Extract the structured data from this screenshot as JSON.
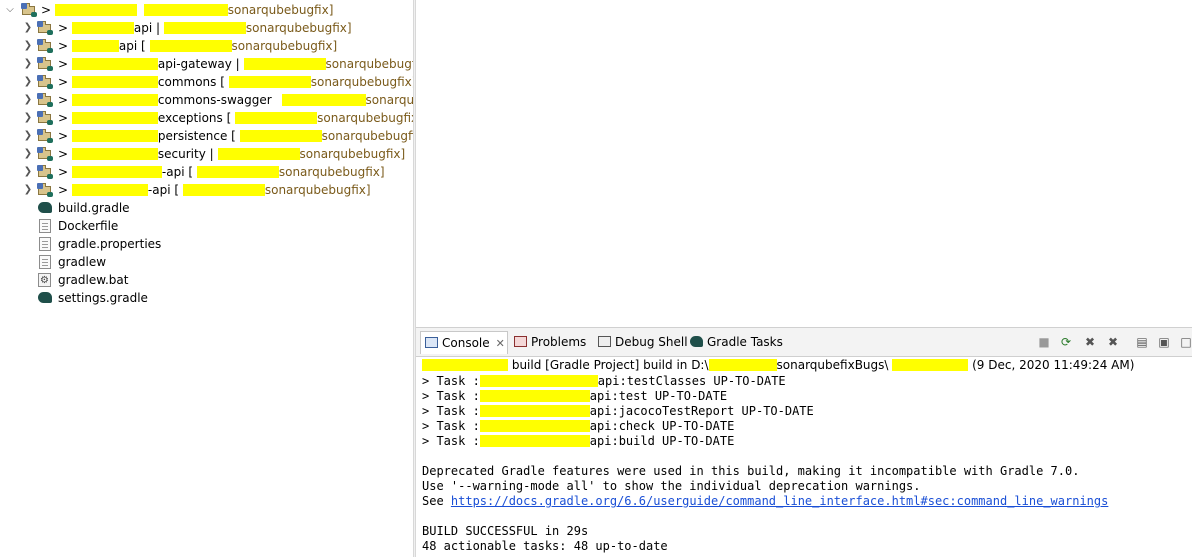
{
  "explorer": {
    "root": {
      "prefix": ">",
      "suffix": "sonarqubebugfix]"
    },
    "projects": [
      {
        "prefix": ">",
        "name": "api |",
        "suffix": "sonarqubebugfix]"
      },
      {
        "prefix": ">",
        "name": "api [",
        "suffix": "sonarqubebugfix]"
      },
      {
        "prefix": ">",
        "name": "api-gateway |",
        "suffix": "sonarqubebugfix]"
      },
      {
        "prefix": ">",
        "name": "commons [",
        "suffix": "sonarqubebugfix]"
      },
      {
        "prefix": ">",
        "name": "commons-swagger",
        "suffix": "sonarqubel"
      },
      {
        "prefix": ">",
        "name": "exceptions [",
        "suffix": "sonarqubebugfix]"
      },
      {
        "prefix": ">",
        "name": "persistence [",
        "suffix": "sonarqubebugfix]"
      },
      {
        "prefix": ">",
        "name": "security |",
        "suffix": "sonarqubebugfix]"
      },
      {
        "prefix": ">",
        "name": "-api [",
        "suffix": "sonarqubebugfix]"
      },
      {
        "prefix": ">",
        "name": "-api [",
        "suffix": "sonarqubebugfix]"
      }
    ],
    "files": [
      {
        "name": "build.gradle",
        "icon": "gradle-elephant-icon"
      },
      {
        "name": "Dockerfile",
        "icon": "text-file-icon"
      },
      {
        "name": "gradle.properties",
        "icon": "properties-file-icon"
      },
      {
        "name": "gradlew",
        "icon": "text-file-icon"
      },
      {
        "name": "gradlew.bat",
        "icon": "batch-file-icon"
      },
      {
        "name": "settings.gradle",
        "icon": "gradle-elephant-icon"
      }
    ]
  },
  "console": {
    "tabs": {
      "console": "Console",
      "problems": "Problems",
      "debug_shell": "Debug Shell",
      "gradle_tasks": "Gradle Tasks"
    },
    "header": {
      "part1": "build [Gradle Project] build in D:\\",
      "part2": "sonarqubefixBugs\\",
      "part3": "(9 Dec, 2020 11:49:24 AM)"
    },
    "tasks": [
      {
        "prefix": "> Task :",
        "suffix": "api:testClasses UP-TO-DATE"
      },
      {
        "prefix": "> Task :",
        "suffix": "api:test UP-TO-DATE"
      },
      {
        "prefix": "> Task :",
        "suffix": "api:jacocoTestReport UP-TO-DATE"
      },
      {
        "prefix": "> Task :",
        "suffix": "api:check UP-TO-DATE"
      },
      {
        "prefix": "> Task :",
        "suffix": "api:build UP-TO-DATE"
      }
    ],
    "deprecation": "Deprecated Gradle features were used in this build, making it incompatible with Gradle 7.0.",
    "warning_mode": "Use '--warning-mode all' to show the individual deprecation warnings.",
    "see_prefix": "See ",
    "link": "https://docs.gradle.org/6.6/userguide/command_line_interface.html#sec:command_line_warnings",
    "result": "BUILD SUCCESSFUL in 29s",
    "summary": "48 actionable tasks: 48 up-to-date"
  },
  "colors": {
    "redaction": "#ffff00",
    "link": "#1a4fd6",
    "decoration": "#7a5a1a"
  }
}
